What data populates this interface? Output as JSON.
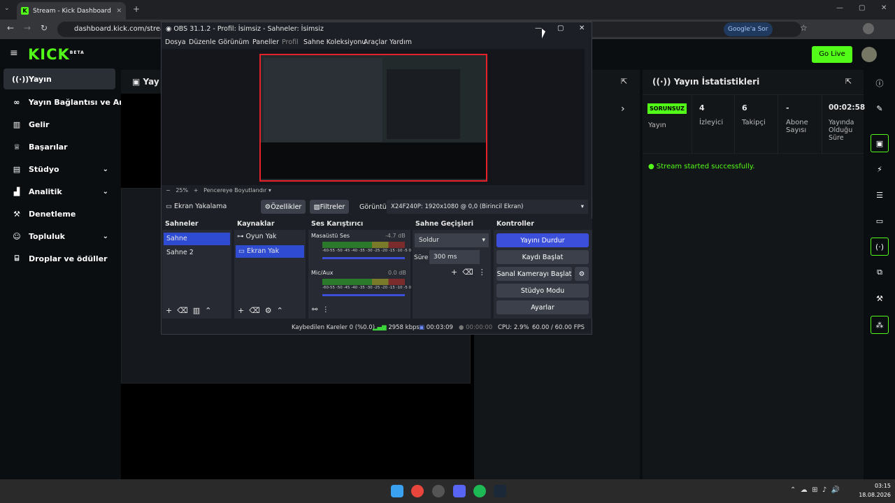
{
  "browser": {
    "tab_title": "Stream - Kick Dashboard",
    "url": "dashboard.kick.com/stream",
    "ask_google": "Google'a Sor"
  },
  "kick": {
    "logo": "KICK",
    "beta": "BETA",
    "go_live": "Go Live",
    "nav": [
      "Yayın",
      "Yayın Bağlantısı ve Anahtar",
      "Gelir",
      "Başarılar",
      "Stüdyo",
      "Analitik",
      "Denetleme",
      "Topluluk",
      "Droplar ve ödüller"
    ],
    "stream_panel_title": "Yay",
    "stats_title": "Yayın İstatistikleri",
    "stats": {
      "status_badge": "SORUNSUZ",
      "status_label": "Yayın",
      "viewers": "4",
      "viewers_label": "İzleyici",
      "followers": "6",
      "followers_label": "Takipçi",
      "subs": "-",
      "subs_label": "Abone Sayısı",
      "uptime": "00:02:58",
      "uptime_label": "Yayında Olduğu Süre"
    },
    "success_msg": "Stream started successfully.",
    "colors": {
      "accent": "#53fc18",
      "bg": "#0b0e11"
    }
  },
  "obs": {
    "title": "OBS 31.1.2 - Profil: İsimsiz - Sahneler: İsimsiz",
    "menu": [
      "Dosya",
      "Düzenle",
      "Görünüm",
      "Paneller",
      "Profil",
      "Sahne Koleksiyonu",
      "Araçlar",
      "Yardım"
    ],
    "zoom": "25%",
    "fit_label": "Pencereye Boyutlandır",
    "source_name": "Ekran Yakalama",
    "properties": "Özellikler",
    "filters": "Filtreler",
    "display_label": "Görüntü",
    "display_value": "X24F240P: 1920x1080 @ 0,0 (Birincil Ekran)",
    "scenes_title": "Sahneler",
    "scenes": [
      "Sahne",
      "Sahne 2"
    ],
    "sources_title": "Kaynaklar",
    "sources": [
      "Oyun Yak",
      "Ekran Yak"
    ],
    "mixer_title": "Ses Karıştırıcı",
    "mixer": [
      {
        "name": "Masaüstü Ses",
        "db": "-4.7 dB"
      },
      {
        "name": "Mic/Aux",
        "db": "0.0 dB"
      }
    ],
    "meter_ticks": "-60-55 -50 -45 -40 -35 -30 -25 -20 -15 -10 -5 0",
    "transitions_title": "Sahne Geçişleri",
    "transition": "Soldur",
    "duration_label": "Süre",
    "duration": "300 ms",
    "controls_title": "Kontroller",
    "controls": [
      "Yayını Durdur",
      "Kaydı Başlat",
      "Sanal Kamerayı Başlat",
      "Stüdyo Modu",
      "Ayarlar"
    ],
    "status": {
      "dropped": "Kaybedilen Kareler 0 (%0.0)",
      "bitrate": "2958 kbps",
      "stream_time": "00:03:09",
      "rec_time": "00:00:00",
      "cpu": "CPU: 2.9%",
      "fps": "60.00 / 60.00 FPS"
    }
  },
  "taskbar": {
    "time": "03:15",
    "date": "18.08.2026"
  }
}
